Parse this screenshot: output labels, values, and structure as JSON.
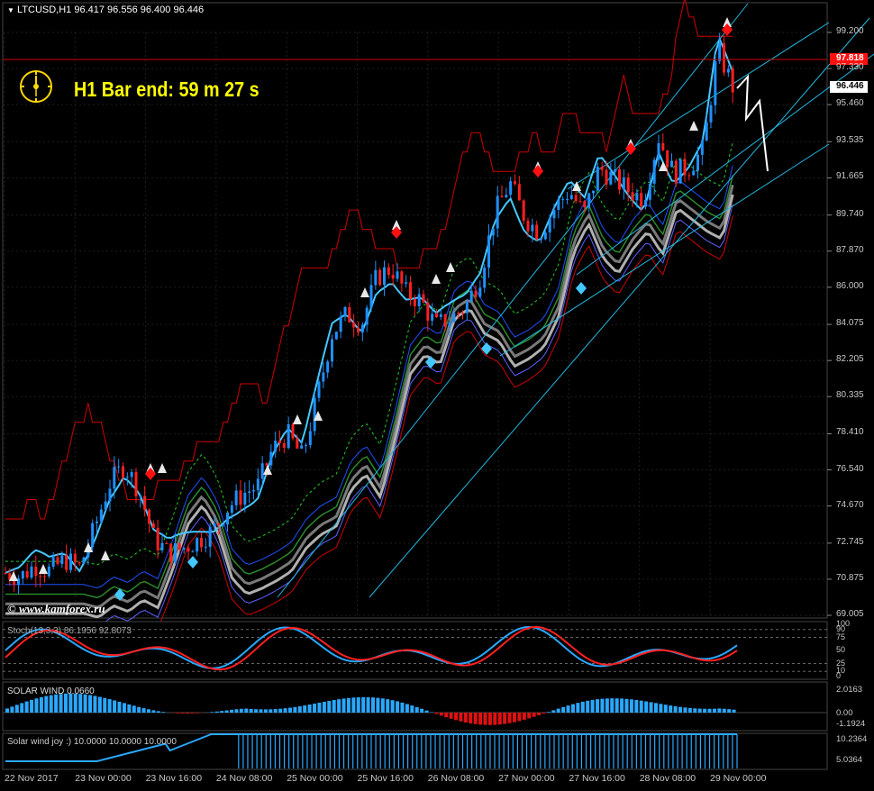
{
  "header": {
    "symbol_label": "LTCUSD,H1",
    "ohlc": "96.417 96.556 96.400 96.446"
  },
  "timer": {
    "label": "H1 Bar end: 59 m 27 s"
  },
  "price_tags": {
    "red_line": "97.818",
    "current": "96.446"
  },
  "watermark": "© www.kamforex.ru",
  "colors": {
    "background": "#000000",
    "bull_candle": "#1e90ff",
    "bear_candle": "#ff2020",
    "resistance_line": "#d00000",
    "channel_line": "#22b8e0",
    "yellow_line": "#ffff00",
    "red_tag": "#ff1010",
    "timer_text": "#ffff00"
  },
  "indicators": {
    "stoch": {
      "label": "Stoch(13,3,3) 86.1956 92.8073",
      "levels": [
        "100",
        "90",
        "75",
        "50",
        "25",
        "10",
        "0"
      ]
    },
    "solar_wind": {
      "label": "SOLAR WIND 0.0660",
      "levels": [
        "2.0163",
        "0.00",
        "-1.1924"
      ]
    },
    "solar_wind_joy": {
      "label": "Solar wind joy :) 10.0000 10.0000 10.0000",
      "levels": [
        "10.2364",
        "5.0364"
      ]
    }
  },
  "chart_data": {
    "type": "candlestick",
    "symbol": "LTCUSD",
    "timeframe": "H1",
    "y_ticks": [
      "99.200",
      "97.330",
      "95.460",
      "93.535",
      "91.665",
      "89.740",
      "87.870",
      "86.000",
      "84.075",
      "82.205",
      "80.335",
      "78.410",
      "76.540",
      "74.670",
      "72.745",
      "70.875",
      "69.005"
    ],
    "ylim": [
      69.005,
      99.2
    ],
    "x_ticks": [
      "22 Nov 2017",
      "23 Nov 00:00",
      "23 Nov 16:00",
      "24 Nov 08:00",
      "25 Nov 00:00",
      "25 Nov 16:00",
      "26 Nov 08:00",
      "27 Nov 00:00",
      "27 Nov 16:00",
      "28 Nov 08:00",
      "29 Nov 00:00"
    ],
    "approx_close_path": [
      71.2,
      71.0,
      71.6,
      71.3,
      71.9,
      71.5,
      73.5,
      75.8,
      76.8,
      75.5,
      73.0,
      72.2,
      72.5,
      72.9,
      73.4,
      74.6,
      75.3,
      75.7,
      77.6,
      78.4,
      77.2,
      80.3,
      83.6,
      84.6,
      84.1,
      86.5,
      87.0,
      85.7,
      85.3,
      84.0,
      84.4,
      85.0,
      86.6,
      89.9,
      91.4,
      89.6,
      88.8,
      90.1,
      91.0,
      89.8,
      92.2,
      91.6,
      91.0,
      90.6,
      93.8,
      91.9,
      92.2,
      93.1,
      98.3,
      96.4
    ]
  }
}
